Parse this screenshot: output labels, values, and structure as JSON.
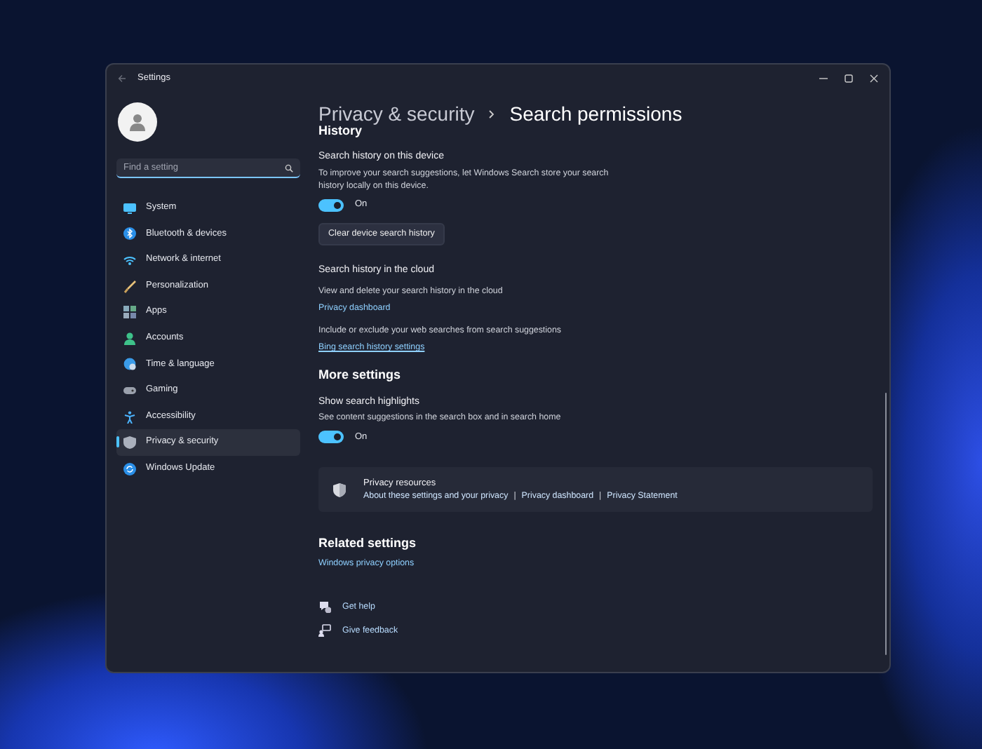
{
  "window": {
    "title": "Settings"
  },
  "search": {
    "placeholder": "Find a setting"
  },
  "nav": [
    {
      "label": "System",
      "selected": false
    },
    {
      "label": "Bluetooth & devices",
      "selected": false
    },
    {
      "label": "Network & internet",
      "selected": false
    },
    {
      "label": "Personalization",
      "selected": false
    },
    {
      "label": "Apps",
      "selected": false
    },
    {
      "label": "Accounts",
      "selected": false
    },
    {
      "label": "Time & language",
      "selected": false
    },
    {
      "label": "Gaming",
      "selected": false
    },
    {
      "label": "Accessibility",
      "selected": false
    },
    {
      "label": "Privacy & security",
      "selected": true
    },
    {
      "label": "Windows Update",
      "selected": false
    }
  ],
  "breadcrumb": {
    "parent": "Privacy & security",
    "current": "Search permissions"
  },
  "history": {
    "heading": "History",
    "device": {
      "title": "Search history on this device",
      "description": "To improve your search suggestions, let Windows Search store your search history locally on this device.",
      "toggle": {
        "on": true,
        "label": "On"
      },
      "button": "Clear device search history"
    },
    "cloud": {
      "title": "Search history in the cloud",
      "items": [
        {
          "description": "View and delete your search history in the cloud",
          "link": "Privacy dashboard",
          "underlined": false
        },
        {
          "description": "Include or exclude your web searches from search suggestions",
          "link": "Bing search history settings",
          "underlined": true
        }
      ]
    }
  },
  "more_settings": {
    "heading": "More settings",
    "title": "Show search highlights",
    "description": "See content suggestions in the search box and in search home",
    "toggle": {
      "on": true,
      "label": "On"
    }
  },
  "privacy_resources": {
    "title": "Privacy resources",
    "links": [
      "About these settings and your privacy",
      "Privacy dashboard",
      "Privacy Statement"
    ],
    "separator": "|"
  },
  "related_settings": {
    "heading": "Related settings",
    "link": "Windows privacy options"
  },
  "footer_links": [
    {
      "label": "Get help"
    },
    {
      "label": "Give feedback"
    }
  ]
}
